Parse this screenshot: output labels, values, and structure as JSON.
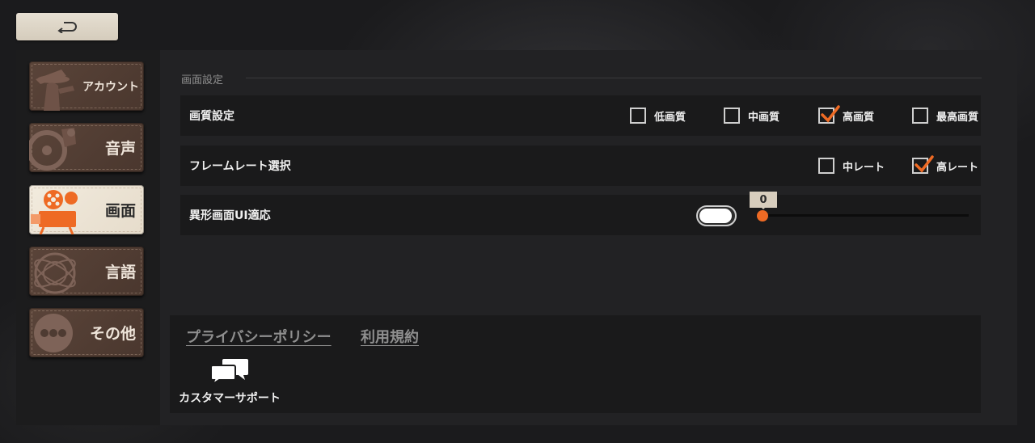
{
  "nav": {
    "items": [
      {
        "label": "アカウント",
        "art": "detective-figure-art",
        "active": false
      },
      {
        "label": "音声",
        "art": "vinyl-record-art",
        "active": false
      },
      {
        "label": "画面",
        "art": "film-projector-art",
        "active": true
      },
      {
        "label": "言語",
        "art": "globe-emblem-art",
        "active": false
      },
      {
        "label": "その他",
        "art": "ellipsis-circle-art",
        "active": false
      }
    ]
  },
  "back_button": {
    "icon": "return-arrow-icon"
  },
  "section": {
    "title": "画面設定"
  },
  "quality": {
    "label": "画質設定",
    "options": [
      {
        "label": "低画質",
        "checked": false
      },
      {
        "label": "中画質",
        "checked": false
      },
      {
        "label": "高画質",
        "checked": true
      },
      {
        "label": "最高画質",
        "checked": false
      }
    ]
  },
  "framerate": {
    "label": "フレームレート選択",
    "options": [
      {
        "label": "中レート",
        "checked": false
      },
      {
        "label": "高レート",
        "checked": true
      }
    ]
  },
  "notch": {
    "label": "異形画面UI適応",
    "toggle_on": false,
    "slider_value": "0"
  },
  "footer": {
    "privacy_link": "プライバシーポリシー",
    "terms_link": "利用規約",
    "support_label": "カスタマーサポート",
    "support_icon": "chat-bubbles-icon"
  },
  "colors": {
    "accent": "#ee6a24",
    "active_tab": "#efe7da",
    "tab": "#55413a"
  }
}
